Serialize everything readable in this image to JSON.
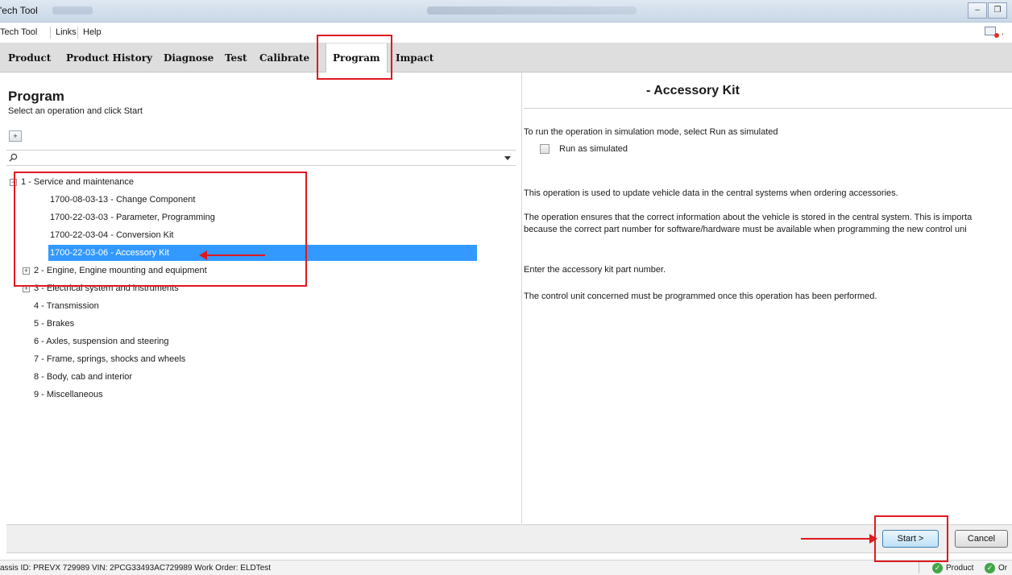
{
  "window": {
    "title": "'ech Tool",
    "controls": {
      "minimize": "–",
      "restore": "❐"
    }
  },
  "menu": {
    "items": [
      "Tech Tool",
      "Links",
      "Help"
    ],
    "right_text": "."
  },
  "tabs": [
    "Product",
    "Product History",
    "Diagnose",
    "Test",
    "Calibrate",
    "Program",
    "Impact"
  ],
  "active_tab": "Program",
  "left": {
    "title": "Program",
    "subtitle": "Select an operation and click Start",
    "expand_label": "+",
    "search_placeholder": "",
    "tree": [
      {
        "label": "1 - Service and maintenance",
        "toggle": "−"
      },
      {
        "label": "1700-08-03-13 - Change Component"
      },
      {
        "label": "1700-22-03-03 - Parameter, Programming"
      },
      {
        "label": "1700-22-03-04 - Conversion Kit"
      },
      {
        "label": "1700-22-03-06 - Accessory Kit",
        "selected": true
      },
      {
        "label": "2 - Engine, Engine mounting and equipment",
        "toggle": "+"
      },
      {
        "label": "3 - Electrical system and instruments",
        "toggle": "+"
      },
      {
        "label": "4 - Transmission"
      },
      {
        "label": "5 - Brakes"
      },
      {
        "label": "6 - Axles, suspension and steering"
      },
      {
        "label": "7 - Frame, springs, shocks and wheels"
      },
      {
        "label": "8 - Body, cab and interior"
      },
      {
        "label": "9 - Miscellaneous"
      }
    ]
  },
  "right": {
    "title": "- Accessory Kit",
    "simulation_text": "To run the operation in simulation mode, select Run as simulated",
    "checkbox_label": "Run as simulated",
    "desc1": "This operation is used to update vehicle data in the central systems when ordering accessories.",
    "desc2a": "The operation ensures that the correct information about the vehicle is stored in the central system. This is importa",
    "desc2b": "because the correct part number for software/hardware must be available when programming the new control uni",
    "desc3": "Enter the accessory kit part number.",
    "desc4": "The control unit concerned must be programmed once this operation has been performed."
  },
  "buttons": {
    "start": "Start >",
    "cancel": "Cancel"
  },
  "status": {
    "info": "assis ID: PREVX 729989   VIN: 2PCG33493AC729989   Work Order: ELDTest",
    "product": "Product",
    "online": "Or"
  },
  "colors": {
    "selection": "#3399ff",
    "annotation": "#e0191f",
    "status_ok": "#43a547"
  }
}
